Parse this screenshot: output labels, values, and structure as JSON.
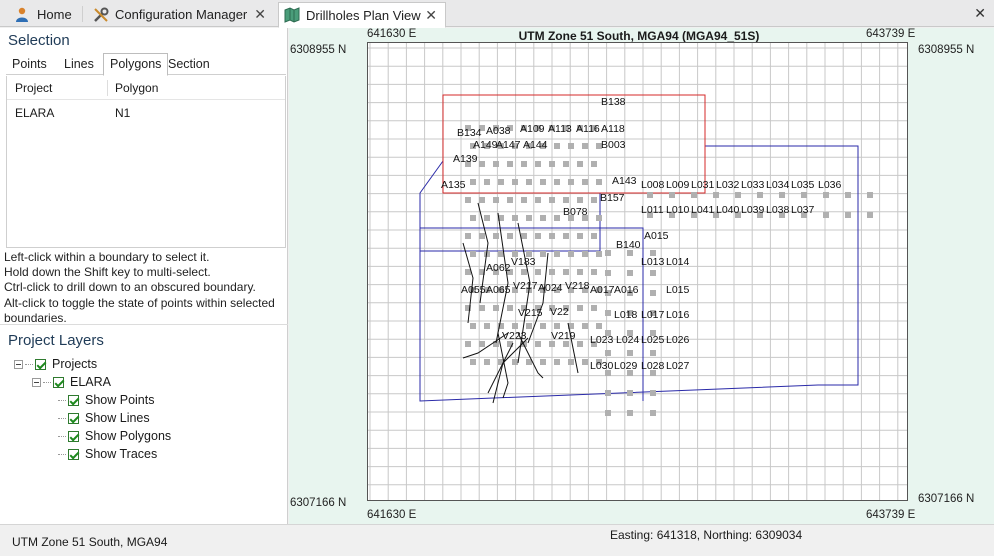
{
  "tabs": [
    {
      "label": "Home",
      "icon": "user-home-icon"
    },
    {
      "label": "Configuration Manager",
      "icon": "tools-icon",
      "close": "✕"
    },
    {
      "label": "Drillholes Plan View",
      "icon": "map-icon",
      "close": "✕",
      "active": true
    }
  ],
  "window_close": "✕",
  "selection": {
    "title": "Selection",
    "tabs": [
      "Points",
      "Lines",
      "Polygons",
      "Section"
    ],
    "active_tab": "Polygons",
    "columns": [
      "Project",
      "Polygon"
    ],
    "rows": [
      {
        "project": "ELARA",
        "polygon": "N1"
      }
    ]
  },
  "help_text": [
    "Left-click within a boundary to select it.",
    "Hold down the Shift key to multi-select.",
    "Ctrl-click to drill down to an obscured boundary.",
    "Alt-click to toggle the state of points within selected",
    "boundaries."
  ],
  "layers": {
    "title": "Project Layers",
    "root": "Projects",
    "project": "ELARA",
    "items": [
      "Show Points",
      "Show Lines",
      "Show Polygons",
      "Show Traces"
    ]
  },
  "map": {
    "title": "UTM Zone 51 South, MGA94 (MGA94_51S)",
    "easting_left": "641630 E",
    "easting_right": "643739 E",
    "northing_top": "6308955 N",
    "northing_bottom": "6307166 N",
    "colors": {
      "selected_polygon": "#d42a2a",
      "polygon": "#2a2aa8",
      "grid": "#c8c8c8",
      "point": "#b0b0b0"
    },
    "point_labels": [
      {
        "t": "B138"
      },
      {
        "t": "B134"
      },
      {
        "t": "A038"
      },
      {
        "t": "A109"
      },
      {
        "t": "A113"
      },
      {
        "t": "A116"
      },
      {
        "t": "A118"
      },
      {
        "t": "A149"
      },
      {
        "t": "A147"
      },
      {
        "t": "A144"
      },
      {
        "t": "B003"
      },
      {
        "t": "A139"
      },
      {
        "t": "A135"
      },
      {
        "t": "A143"
      },
      {
        "t": "L008"
      },
      {
        "t": "L009"
      },
      {
        "t": "L031"
      },
      {
        "t": "L032"
      },
      {
        "t": "L033"
      },
      {
        "t": "L034"
      },
      {
        "t": "L035"
      },
      {
        "t": "L036"
      },
      {
        "t": "L011"
      },
      {
        "t": "L010"
      },
      {
        "t": "L041"
      },
      {
        "t": "L040"
      },
      {
        "t": "L039"
      },
      {
        "t": "L038"
      },
      {
        "t": "L037"
      },
      {
        "t": "B078"
      },
      {
        "t": "B157"
      },
      {
        "t": "A015"
      },
      {
        "t": "B140"
      },
      {
        "t": "L013"
      },
      {
        "t": "L014"
      },
      {
        "t": "A062"
      },
      {
        "t": "V183"
      },
      {
        "t": "A055"
      },
      {
        "t": "A065"
      },
      {
        "t": "V217"
      },
      {
        "t": "A024"
      },
      {
        "t": "V218"
      },
      {
        "t": "A017"
      },
      {
        "t": "A016"
      },
      {
        "t": "L015"
      },
      {
        "t": "L018"
      },
      {
        "t": "L017"
      },
      {
        "t": "L016"
      },
      {
        "t": "V223"
      },
      {
        "t": "V219"
      },
      {
        "t": "L023"
      },
      {
        "t": "L024"
      },
      {
        "t": "L025"
      },
      {
        "t": "L026"
      },
      {
        "t": "L030"
      },
      {
        "t": "L029"
      },
      {
        "t": "L028"
      },
      {
        "t": "L027"
      },
      {
        "t": "V22"
      },
      {
        "t": "V215"
      }
    ]
  },
  "status": {
    "left": "UTM Zone 51 South, MGA94",
    "right": "Easting: 641318, Northing: 6309034"
  }
}
